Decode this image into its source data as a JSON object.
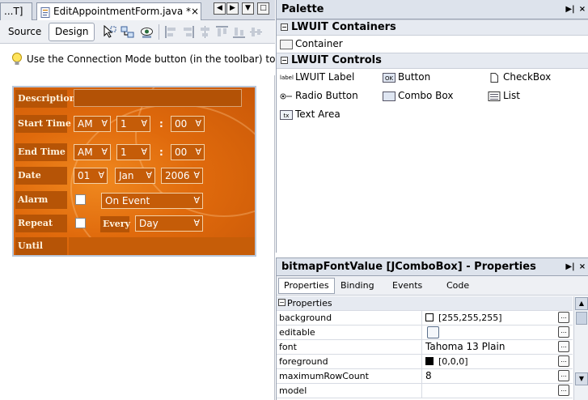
{
  "editor": {
    "tabs": [
      {
        "label": "...T]"
      },
      {
        "label": "EditAppointmentForm.java *",
        "active": true,
        "close": "×"
      }
    ],
    "tab_controls": {
      "prev": "◀",
      "next": "▶",
      "list": "▼",
      "maximize": "□"
    },
    "modes": {
      "source": "Source",
      "design": "Design"
    },
    "hint_text": "Use the Connection Mode button (in the toolbar) to e"
  },
  "form": {
    "labels": {
      "description": "Description",
      "start_time": "Start Time",
      "end_time": "End Time",
      "date": "Date",
      "alarm": "Alarm",
      "repeat": "Repeat",
      "until": "Until",
      "every": "Every"
    },
    "start_time": {
      "ampm": "AM",
      "hour": "1",
      "colon": ":",
      "minute": "00"
    },
    "end_time": {
      "ampm": "AM",
      "hour": "1",
      "colon": ":",
      "minute": "00"
    },
    "date": {
      "day": "01",
      "month": "Jan",
      "year": "2006"
    },
    "alarm_value": "On Event",
    "repeat_value": "Day",
    "combo_arrow": "∀"
  },
  "palette": {
    "title": "Palette",
    "header_controls": {
      "pin": "▶|",
      "close": "×"
    },
    "categories": [
      {
        "name": "LWUIT Containers",
        "toggle": "−",
        "items": [
          {
            "label": "Container",
            "icon": "container-icon"
          }
        ]
      },
      {
        "name": "LWUIT Controls",
        "toggle": "−",
        "items": [
          {
            "label": "LWUIT Label",
            "icon": "label-icon",
            "icon_text": "label"
          },
          {
            "label": "Button",
            "icon": "button-icon",
            "icon_text": "OK"
          },
          {
            "label": "CheckBox",
            "icon": "checkbox-icon"
          },
          {
            "label": "Radio Button",
            "icon": "radio-button-icon"
          },
          {
            "label": "Combo Box",
            "icon": "combo-box-icon"
          },
          {
            "label": "List",
            "icon": "list-icon"
          },
          {
            "label": "Text Area",
            "icon": "text-area-icon",
            "icon_text": "tx"
          }
        ]
      }
    ]
  },
  "properties": {
    "title": "bitmapFontValue [JComboBox] - Properties",
    "header_controls": {
      "pin": "▶|",
      "close": "×"
    },
    "tabs": [
      "Properties",
      "Binding",
      "Events",
      "Code"
    ],
    "section": {
      "toggle": "−",
      "label": "Properties"
    },
    "rows": [
      {
        "name": "background",
        "value": "[255,255,255]",
        "swatch": "#ffffff",
        "button": "..."
      },
      {
        "name": "editable",
        "value": "",
        "checkbox": true,
        "button": "..."
      },
      {
        "name": "font",
        "value": "Tahoma 13 Plain",
        "button": "..."
      },
      {
        "name": "foreground",
        "value": "[0,0,0]",
        "swatch": "#000000",
        "button": "..."
      },
      {
        "name": "maximumRowCount",
        "value": "8",
        "button": "..."
      },
      {
        "name": "model",
        "value": "",
        "button": "..."
      }
    ],
    "scroll": {
      "up": "▲",
      "down": "▼"
    }
  },
  "colors": {
    "form_background": "#e0670a",
    "form_label_background": "#b65406",
    "panel_header": "#dde3ec"
  }
}
